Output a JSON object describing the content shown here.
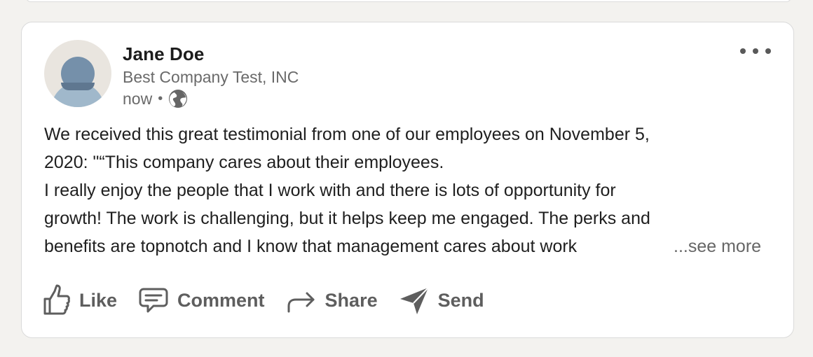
{
  "post": {
    "author_name": "Jane Doe",
    "author_company": "Best Company Test, INC",
    "timestamp": "now",
    "separator": "•",
    "visibility_icon": "globe-icon",
    "more_icon": "more-horizontal-icon",
    "body_lines": [
      "We received this great testimonial from one of our employees on November 5,",
      "2020: \"“This company cares about their employees.",
      "I really enjoy the people that I work with and there is lots of opportunity for",
      "growth! The work is challenging, but it helps keep me engaged. The perks and"
    ],
    "body_last_line": "benefits are topnotch and I know that management cares about work",
    "see_more": "...see more"
  },
  "actions": {
    "like": {
      "label": "Like",
      "icon": "thumbs-up-icon"
    },
    "comment": {
      "label": "Comment",
      "icon": "comment-icon"
    },
    "share": {
      "label": "Share",
      "icon": "share-arrow-icon"
    },
    "send": {
      "label": "Send",
      "icon": "send-icon"
    }
  },
  "colors": {
    "background": "#f3f2ef",
    "card": "#ffffff",
    "text": "#1f1f1f",
    "muted": "#6a6a6a",
    "action": "#5e5e5e"
  }
}
